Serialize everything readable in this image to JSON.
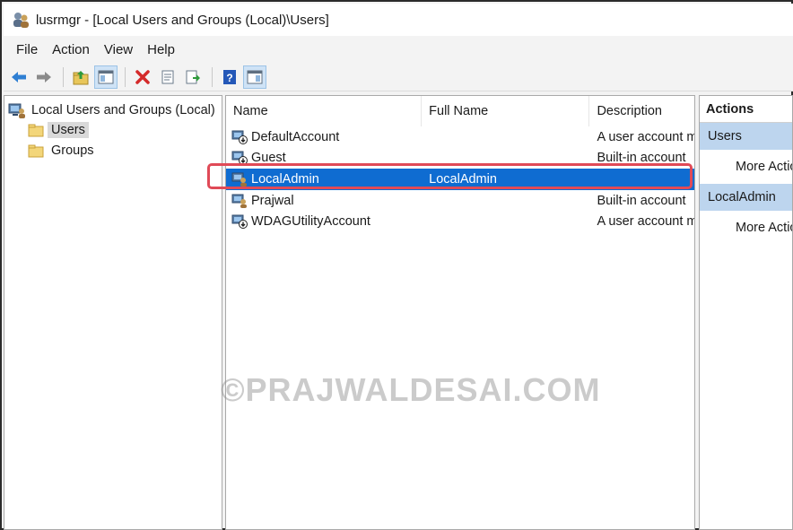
{
  "window": {
    "title": "lusrmgr - [Local Users and Groups (Local)\\Users]",
    "icon": "users-group-icon"
  },
  "menu": {
    "items": [
      "File",
      "Action",
      "View",
      "Help"
    ]
  },
  "toolbar": {
    "buttons": [
      "back-arrow-icon",
      "forward-arrow-icon",
      "up-folder-icon",
      "show-hide-tree-icon",
      "delete-icon",
      "properties-icon",
      "export-list-icon",
      "help-icon",
      "show-hide-action-pane-icon"
    ]
  },
  "tree": {
    "root": "Local Users and Groups (Local)",
    "children": [
      {
        "label": "Users",
        "selected": true
      },
      {
        "label": "Groups",
        "selected": false
      }
    ]
  },
  "list": {
    "columns": [
      "Name",
      "Full Name",
      "Description"
    ],
    "rows": [
      {
        "name": "DefaultAccount",
        "full_name": "",
        "description": "A user account m"
      },
      {
        "name": "Guest",
        "full_name": "",
        "description": "Built-in account"
      },
      {
        "name": "LocalAdmin",
        "full_name": "LocalAdmin",
        "description": "",
        "selected": true
      },
      {
        "name": "Prajwal",
        "full_name": "",
        "description": "Built-in account"
      },
      {
        "name": "WDAGUtilityAccount",
        "full_name": "",
        "description": "A user account m"
      }
    ]
  },
  "actions": {
    "title": "Actions",
    "sections": [
      {
        "header": "Users",
        "item": "More Actions"
      },
      {
        "header": "LocalAdmin",
        "item": "More Actions"
      }
    ]
  },
  "watermark": "©PRAJWALDESAI.COM",
  "colors": {
    "selection": "#0f6cd1",
    "highlight_outline": "#e04a57",
    "section_header": "#bdd5ee"
  }
}
